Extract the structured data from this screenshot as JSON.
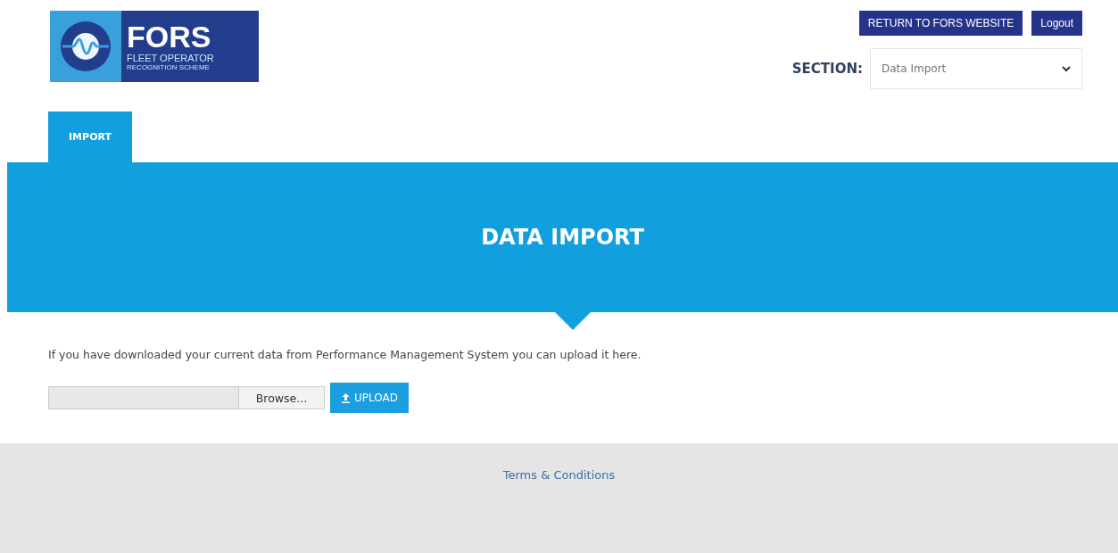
{
  "logo": {
    "title": "FORS",
    "subtitle": "FLEET OPERATOR",
    "tagline": "RECOGNITION SCHEME"
  },
  "header_buttons": [
    "RETURN TO FORS WEBSITE",
    "Logout"
  ],
  "section": {
    "label": "SECTION:",
    "value": "Data Import"
  },
  "tabs": [
    {
      "label": "IMPORT",
      "selected": true
    }
  ],
  "banner": {
    "title": "DATA IMPORT"
  },
  "intro": "If you have downloaded your current data from Performance Management System you can upload it here.",
  "upload": {
    "browse": "Browse...",
    "button": "UPLOAD"
  },
  "footer": {
    "link": "Terms & Conditions"
  }
}
